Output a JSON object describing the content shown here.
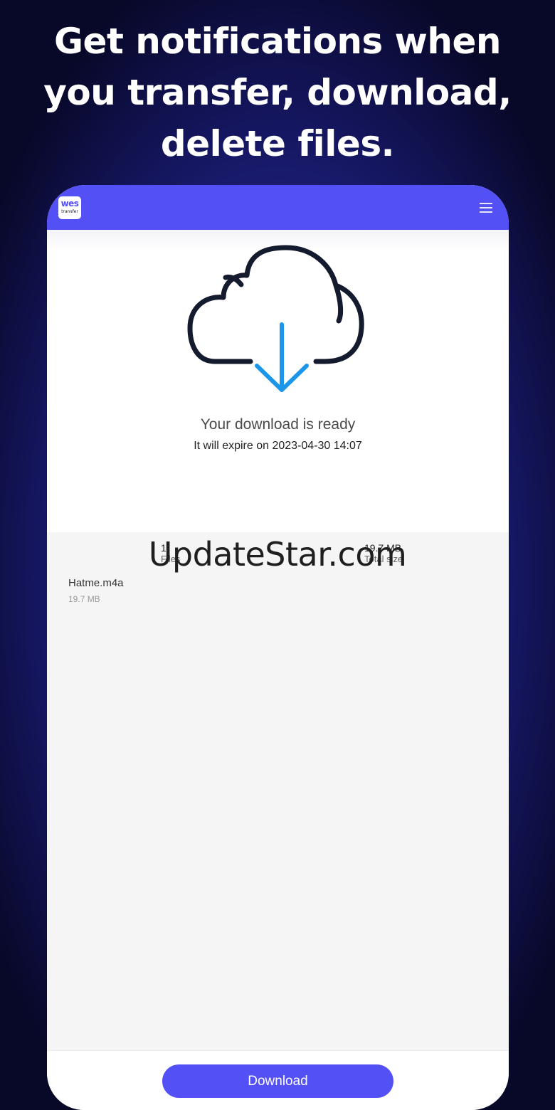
{
  "promo": {
    "headline_line1": "Get notifications when",
    "headline_line2": "you transfer, download,",
    "headline_line3": "delete files."
  },
  "app": {
    "logo_top": "wes",
    "logo_bottom": "transfer",
    "accent_color": "#5350f6",
    "menu_icon": "hamburger-menu-icon"
  },
  "hero": {
    "icon": "cloud-download-icon",
    "title": "Your download is ready",
    "expire_text": "It will expire on 2023-04-30 14:07"
  },
  "stats": {
    "files_count": "1",
    "files_label": "Files",
    "total_size": "19.7 MB",
    "total_size_label": "Total size"
  },
  "files": [
    {
      "name": "Hatme.m4a",
      "size": "19.7 MB"
    }
  ],
  "actions": {
    "download_label": "Download"
  },
  "watermark": "UpdateStar.com"
}
